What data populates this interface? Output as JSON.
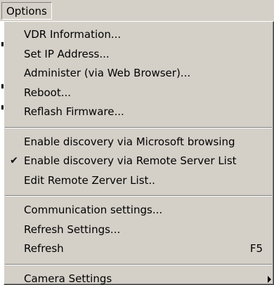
{
  "menubar": {
    "options_label": "Options"
  },
  "menu": {
    "items": [
      {
        "label": "VDR Information...",
        "checked": false
      },
      {
        "label": "Set IP Address...",
        "checked": false
      },
      {
        "label": "Administer (via Web Browser)...",
        "checked": false
      },
      {
        "label": "Reboot...",
        "checked": false
      },
      {
        "label": "Reflash Firmware...",
        "checked": false
      },
      {
        "label": "Enable discovery via Microsoft browsing",
        "checked": false
      },
      {
        "label": "Enable discovery via Remote Server List",
        "checked": true,
        "check_glyph": "✔"
      },
      {
        "label": "Edit Remote Zerver List..",
        "checked": false
      },
      {
        "label": "Communication settings...",
        "checked": false
      },
      {
        "label": "Refresh Settings...",
        "checked": false
      },
      {
        "label": "Refresh",
        "shortcut": "F5",
        "checked": false
      },
      {
        "label": "Camera Settings",
        "submenu": true,
        "checked": false
      }
    ]
  },
  "colors": {
    "menu_face": "#d4d0c8",
    "text": "#000000"
  }
}
